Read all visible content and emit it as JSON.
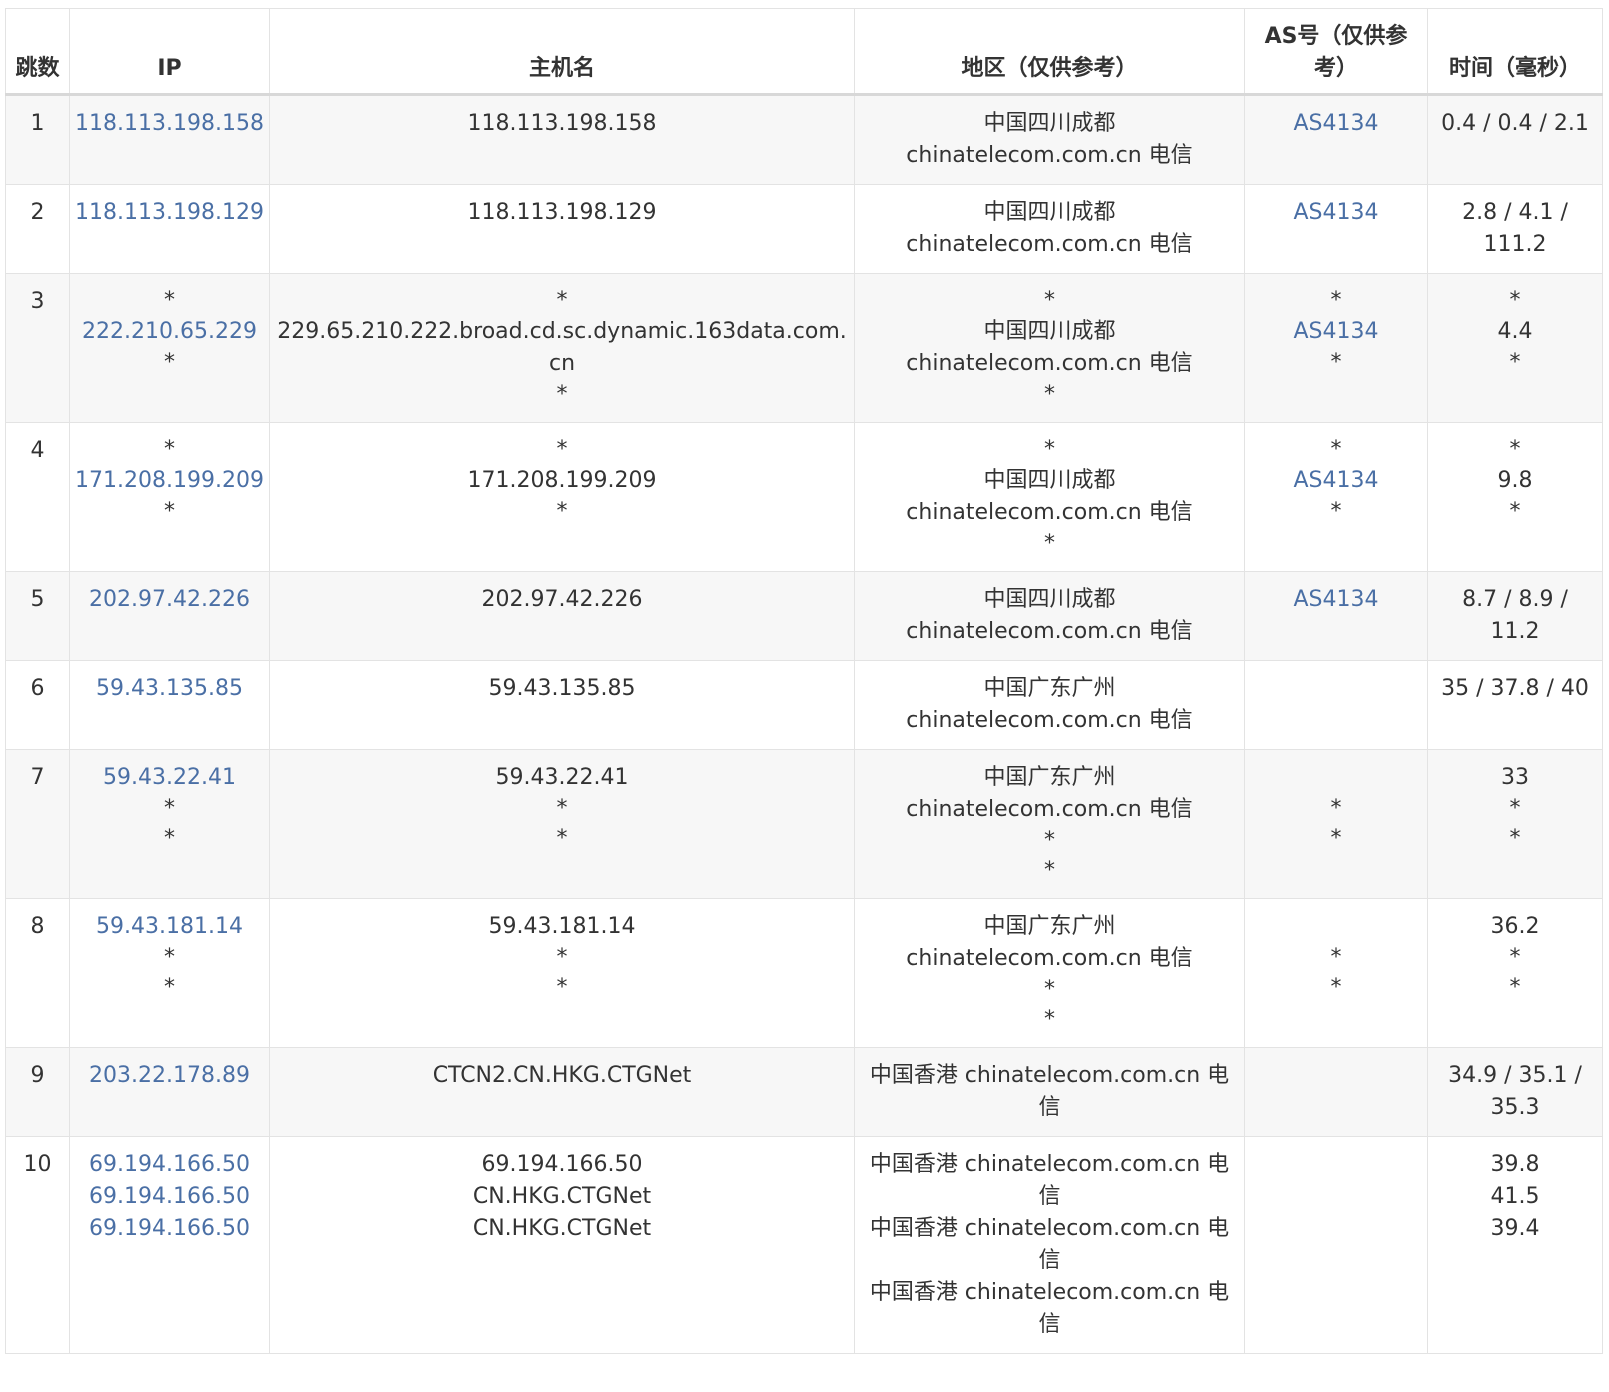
{
  "headers": {
    "hop": "跳数",
    "ip": "IP",
    "host": "主机名",
    "region": "地区（仅供参考）",
    "as": "AS号（仅供参考）",
    "time": "时间（毫秒）"
  },
  "rows": [
    {
      "hop": "1",
      "ip": [
        "118.113.198.158"
      ],
      "host": [
        "118.113.198.158"
      ],
      "region": [
        "中国四川成都",
        "chinatelecom.com.cn 电信"
      ],
      "as": [
        "AS4134"
      ],
      "time": [
        "0.4 / 0.4 / 2.1"
      ]
    },
    {
      "hop": "2",
      "ip": [
        "118.113.198.129"
      ],
      "host": [
        "118.113.198.129"
      ],
      "region": [
        "中国四川成都",
        "chinatelecom.com.cn 电信"
      ],
      "as": [
        "AS4134"
      ],
      "time": [
        "2.8 / 4.1 /",
        "111.2"
      ]
    },
    {
      "hop": "3",
      "ip": [
        "*",
        "222.210.65.229",
        "*"
      ],
      "host": [
        "*",
        "229.65.210.222.broad.cd.sc.dynamic.163data.com.cn",
        "*"
      ],
      "region": [
        "*",
        "中国四川成都",
        "chinatelecom.com.cn 电信",
        "*"
      ],
      "as": [
        "*",
        "AS4134",
        "*"
      ],
      "time": [
        "*",
        "4.4",
        "*"
      ]
    },
    {
      "hop": "4",
      "ip": [
        "*",
        "171.208.199.209",
        "*"
      ],
      "host": [
        "*",
        "171.208.199.209",
        "*"
      ],
      "region": [
        "*",
        "中国四川成都",
        "chinatelecom.com.cn 电信",
        "*"
      ],
      "as": [
        "*",
        "AS4134",
        "*"
      ],
      "time": [
        "*",
        "9.8",
        "*"
      ]
    },
    {
      "hop": "5",
      "ip": [
        "202.97.42.226"
      ],
      "host": [
        "202.97.42.226"
      ],
      "region": [
        "中国四川成都",
        "chinatelecom.com.cn 电信"
      ],
      "as": [
        "AS4134"
      ],
      "time": [
        "8.7 / 8.9 /",
        "11.2"
      ]
    },
    {
      "hop": "6",
      "ip": [
        "59.43.135.85"
      ],
      "host": [
        "59.43.135.85"
      ],
      "region": [
        "中国广东广州",
        "chinatelecom.com.cn 电信"
      ],
      "as": [],
      "time": [
        "35 / 37.8 / 40"
      ]
    },
    {
      "hop": "7",
      "ip": [
        "59.43.22.41",
        "*",
        "*"
      ],
      "host": [
        "59.43.22.41",
        "*",
        "*"
      ],
      "region": [
        "中国广东广州",
        "chinatelecom.com.cn 电信",
        "*",
        "*"
      ],
      "as": [
        "",
        "*",
        "*"
      ],
      "time": [
        "33",
        "*",
        "*"
      ]
    },
    {
      "hop": "8",
      "ip": [
        "59.43.181.14",
        "*",
        "*"
      ],
      "host": [
        "59.43.181.14",
        "*",
        "*"
      ],
      "region": [
        "中国广东广州",
        "chinatelecom.com.cn 电信",
        "*",
        "*"
      ],
      "as": [
        "",
        "*",
        "*"
      ],
      "time": [
        "36.2",
        "*",
        "*"
      ]
    },
    {
      "hop": "9",
      "ip": [
        "203.22.178.89"
      ],
      "host": [
        "CTCN2.CN.HKG.CTGNet"
      ],
      "region": [
        "中国香港 chinatelecom.com.cn 电信"
      ],
      "as": [],
      "time": [
        "34.9 / 35.1 /",
        "35.3"
      ]
    },
    {
      "hop": "10",
      "ip": [
        "69.194.166.50",
        "69.194.166.50",
        "69.194.166.50"
      ],
      "host": [
        "69.194.166.50",
        "CN.HKG.CTGNet",
        "CN.HKG.CTGNet"
      ],
      "region": [
        "中国香港 chinatelecom.com.cn 电信",
        "中国香港 chinatelecom.com.cn 电信",
        "中国香港 chinatelecom.com.cn 电信"
      ],
      "as": [],
      "time": [
        "39.8",
        "41.5",
        "39.4"
      ]
    }
  ],
  "colors": {
    "link": "#4a6fa5",
    "text": "#333333",
    "row_alt": "#f7f7f7",
    "border": "#e3e3e3"
  }
}
